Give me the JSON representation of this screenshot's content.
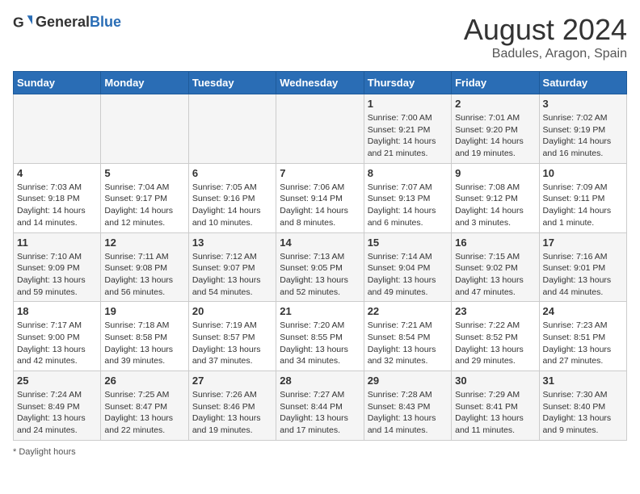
{
  "logo": {
    "general": "General",
    "blue": "Blue"
  },
  "title": "August 2024",
  "subtitle": "Badules, Aragon, Spain",
  "days_of_week": [
    "Sunday",
    "Monday",
    "Tuesday",
    "Wednesday",
    "Thursday",
    "Friday",
    "Saturday"
  ],
  "weeks": [
    [
      {
        "day": "",
        "info": ""
      },
      {
        "day": "",
        "info": ""
      },
      {
        "day": "",
        "info": ""
      },
      {
        "day": "",
        "info": ""
      },
      {
        "day": "1",
        "info": "Sunrise: 7:00 AM\nSunset: 9:21 PM\nDaylight: 14 hours and 21 minutes."
      },
      {
        "day": "2",
        "info": "Sunrise: 7:01 AM\nSunset: 9:20 PM\nDaylight: 14 hours and 19 minutes."
      },
      {
        "day": "3",
        "info": "Sunrise: 7:02 AM\nSunset: 9:19 PM\nDaylight: 14 hours and 16 minutes."
      }
    ],
    [
      {
        "day": "4",
        "info": "Sunrise: 7:03 AM\nSunset: 9:18 PM\nDaylight: 14 hours and 14 minutes."
      },
      {
        "day": "5",
        "info": "Sunrise: 7:04 AM\nSunset: 9:17 PM\nDaylight: 14 hours and 12 minutes."
      },
      {
        "day": "6",
        "info": "Sunrise: 7:05 AM\nSunset: 9:16 PM\nDaylight: 14 hours and 10 minutes."
      },
      {
        "day": "7",
        "info": "Sunrise: 7:06 AM\nSunset: 9:14 PM\nDaylight: 14 hours and 8 minutes."
      },
      {
        "day": "8",
        "info": "Sunrise: 7:07 AM\nSunset: 9:13 PM\nDaylight: 14 hours and 6 minutes."
      },
      {
        "day": "9",
        "info": "Sunrise: 7:08 AM\nSunset: 9:12 PM\nDaylight: 14 hours and 3 minutes."
      },
      {
        "day": "10",
        "info": "Sunrise: 7:09 AM\nSunset: 9:11 PM\nDaylight: 14 hours and 1 minute."
      }
    ],
    [
      {
        "day": "11",
        "info": "Sunrise: 7:10 AM\nSunset: 9:09 PM\nDaylight: 13 hours and 59 minutes."
      },
      {
        "day": "12",
        "info": "Sunrise: 7:11 AM\nSunset: 9:08 PM\nDaylight: 13 hours and 56 minutes."
      },
      {
        "day": "13",
        "info": "Sunrise: 7:12 AM\nSunset: 9:07 PM\nDaylight: 13 hours and 54 minutes."
      },
      {
        "day": "14",
        "info": "Sunrise: 7:13 AM\nSunset: 9:05 PM\nDaylight: 13 hours and 52 minutes."
      },
      {
        "day": "15",
        "info": "Sunrise: 7:14 AM\nSunset: 9:04 PM\nDaylight: 13 hours and 49 minutes."
      },
      {
        "day": "16",
        "info": "Sunrise: 7:15 AM\nSunset: 9:02 PM\nDaylight: 13 hours and 47 minutes."
      },
      {
        "day": "17",
        "info": "Sunrise: 7:16 AM\nSunset: 9:01 PM\nDaylight: 13 hours and 44 minutes."
      }
    ],
    [
      {
        "day": "18",
        "info": "Sunrise: 7:17 AM\nSunset: 9:00 PM\nDaylight: 13 hours and 42 minutes."
      },
      {
        "day": "19",
        "info": "Sunrise: 7:18 AM\nSunset: 8:58 PM\nDaylight: 13 hours and 39 minutes."
      },
      {
        "day": "20",
        "info": "Sunrise: 7:19 AM\nSunset: 8:57 PM\nDaylight: 13 hours and 37 minutes."
      },
      {
        "day": "21",
        "info": "Sunrise: 7:20 AM\nSunset: 8:55 PM\nDaylight: 13 hours and 34 minutes."
      },
      {
        "day": "22",
        "info": "Sunrise: 7:21 AM\nSunset: 8:54 PM\nDaylight: 13 hours and 32 minutes."
      },
      {
        "day": "23",
        "info": "Sunrise: 7:22 AM\nSunset: 8:52 PM\nDaylight: 13 hours and 29 minutes."
      },
      {
        "day": "24",
        "info": "Sunrise: 7:23 AM\nSunset: 8:51 PM\nDaylight: 13 hours and 27 minutes."
      }
    ],
    [
      {
        "day": "25",
        "info": "Sunrise: 7:24 AM\nSunset: 8:49 PM\nDaylight: 13 hours and 24 minutes."
      },
      {
        "day": "26",
        "info": "Sunrise: 7:25 AM\nSunset: 8:47 PM\nDaylight: 13 hours and 22 minutes."
      },
      {
        "day": "27",
        "info": "Sunrise: 7:26 AM\nSunset: 8:46 PM\nDaylight: 13 hours and 19 minutes."
      },
      {
        "day": "28",
        "info": "Sunrise: 7:27 AM\nSunset: 8:44 PM\nDaylight: 13 hours and 17 minutes."
      },
      {
        "day": "29",
        "info": "Sunrise: 7:28 AM\nSunset: 8:43 PM\nDaylight: 13 hours and 14 minutes."
      },
      {
        "day": "30",
        "info": "Sunrise: 7:29 AM\nSunset: 8:41 PM\nDaylight: 13 hours and 11 minutes."
      },
      {
        "day": "31",
        "info": "Sunrise: 7:30 AM\nSunset: 8:40 PM\nDaylight: 13 hours and 9 minutes."
      }
    ]
  ],
  "footer": "Daylight hours"
}
